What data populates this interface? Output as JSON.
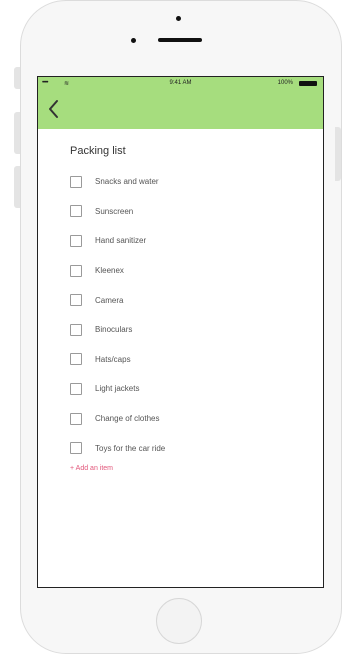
{
  "status_bar": {
    "signal_dots": "•••••",
    "wifi": "≋",
    "time": "9:41 AM",
    "battery_text": "100%"
  },
  "nav": {
    "back_icon": "chevron-left-icon"
  },
  "list": {
    "title": "Packing list",
    "items": [
      {
        "label": "Snacks and water",
        "checked": false
      },
      {
        "label": "Sunscreen",
        "checked": false
      },
      {
        "label": "Hand sanitizer",
        "checked": false
      },
      {
        "label": "Kleenex",
        "checked": false
      },
      {
        "label": "Camera",
        "checked": false
      },
      {
        "label": "Binoculars",
        "checked": false
      },
      {
        "label": "Hats/caps",
        "checked": false
      },
      {
        "label": "Light jackets",
        "checked": false
      },
      {
        "label": "Change of clothes",
        "checked": false
      },
      {
        "label": "Toys for the car ride",
        "checked": false
      }
    ],
    "add_item_label": "+ Add an item"
  },
  "colors": {
    "header_green": "#a6dd7e",
    "add_item_pink": "#e2577b"
  }
}
